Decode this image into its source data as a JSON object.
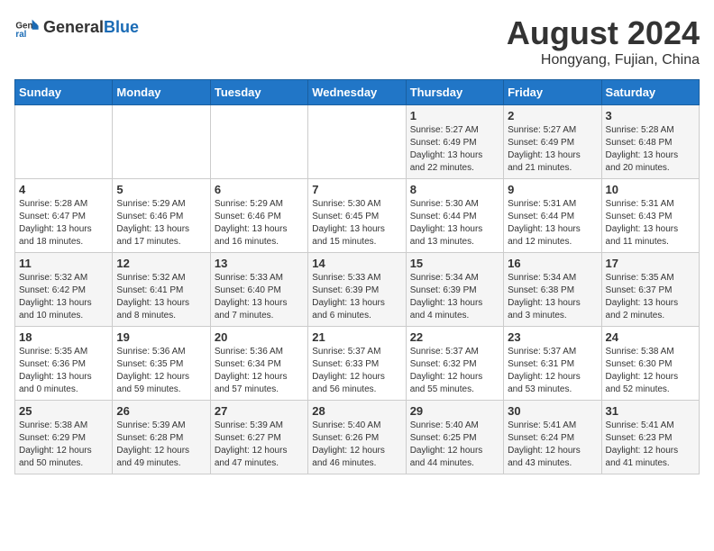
{
  "header": {
    "logo": {
      "general": "General",
      "blue": "Blue"
    },
    "title": "August 2024",
    "location": "Hongyang, Fujian, China"
  },
  "calendar": {
    "days_of_week": [
      "Sunday",
      "Monday",
      "Tuesday",
      "Wednesday",
      "Thursday",
      "Friday",
      "Saturday"
    ],
    "weeks": [
      [
        {
          "day": "",
          "info": ""
        },
        {
          "day": "",
          "info": ""
        },
        {
          "day": "",
          "info": ""
        },
        {
          "day": "",
          "info": ""
        },
        {
          "day": "1",
          "info": "Sunrise: 5:27 AM\nSunset: 6:49 PM\nDaylight: 13 hours and 22 minutes."
        },
        {
          "day": "2",
          "info": "Sunrise: 5:27 AM\nSunset: 6:49 PM\nDaylight: 13 hours and 21 minutes."
        },
        {
          "day": "3",
          "info": "Sunrise: 5:28 AM\nSunset: 6:48 PM\nDaylight: 13 hours and 20 minutes."
        }
      ],
      [
        {
          "day": "4",
          "info": "Sunrise: 5:28 AM\nSunset: 6:47 PM\nDaylight: 13 hours and 18 minutes."
        },
        {
          "day": "5",
          "info": "Sunrise: 5:29 AM\nSunset: 6:46 PM\nDaylight: 13 hours and 17 minutes."
        },
        {
          "day": "6",
          "info": "Sunrise: 5:29 AM\nSunset: 6:46 PM\nDaylight: 13 hours and 16 minutes."
        },
        {
          "day": "7",
          "info": "Sunrise: 5:30 AM\nSunset: 6:45 PM\nDaylight: 13 hours and 15 minutes."
        },
        {
          "day": "8",
          "info": "Sunrise: 5:30 AM\nSunset: 6:44 PM\nDaylight: 13 hours and 13 minutes."
        },
        {
          "day": "9",
          "info": "Sunrise: 5:31 AM\nSunset: 6:44 PM\nDaylight: 13 hours and 12 minutes."
        },
        {
          "day": "10",
          "info": "Sunrise: 5:31 AM\nSunset: 6:43 PM\nDaylight: 13 hours and 11 minutes."
        }
      ],
      [
        {
          "day": "11",
          "info": "Sunrise: 5:32 AM\nSunset: 6:42 PM\nDaylight: 13 hours and 10 minutes."
        },
        {
          "day": "12",
          "info": "Sunrise: 5:32 AM\nSunset: 6:41 PM\nDaylight: 13 hours and 8 minutes."
        },
        {
          "day": "13",
          "info": "Sunrise: 5:33 AM\nSunset: 6:40 PM\nDaylight: 13 hours and 7 minutes."
        },
        {
          "day": "14",
          "info": "Sunrise: 5:33 AM\nSunset: 6:39 PM\nDaylight: 13 hours and 6 minutes."
        },
        {
          "day": "15",
          "info": "Sunrise: 5:34 AM\nSunset: 6:39 PM\nDaylight: 13 hours and 4 minutes."
        },
        {
          "day": "16",
          "info": "Sunrise: 5:34 AM\nSunset: 6:38 PM\nDaylight: 13 hours and 3 minutes."
        },
        {
          "day": "17",
          "info": "Sunrise: 5:35 AM\nSunset: 6:37 PM\nDaylight: 13 hours and 2 minutes."
        }
      ],
      [
        {
          "day": "18",
          "info": "Sunrise: 5:35 AM\nSunset: 6:36 PM\nDaylight: 13 hours and 0 minutes."
        },
        {
          "day": "19",
          "info": "Sunrise: 5:36 AM\nSunset: 6:35 PM\nDaylight: 12 hours and 59 minutes."
        },
        {
          "day": "20",
          "info": "Sunrise: 5:36 AM\nSunset: 6:34 PM\nDaylight: 12 hours and 57 minutes."
        },
        {
          "day": "21",
          "info": "Sunrise: 5:37 AM\nSunset: 6:33 PM\nDaylight: 12 hours and 56 minutes."
        },
        {
          "day": "22",
          "info": "Sunrise: 5:37 AM\nSunset: 6:32 PM\nDaylight: 12 hours and 55 minutes."
        },
        {
          "day": "23",
          "info": "Sunrise: 5:37 AM\nSunset: 6:31 PM\nDaylight: 12 hours and 53 minutes."
        },
        {
          "day": "24",
          "info": "Sunrise: 5:38 AM\nSunset: 6:30 PM\nDaylight: 12 hours and 52 minutes."
        }
      ],
      [
        {
          "day": "25",
          "info": "Sunrise: 5:38 AM\nSunset: 6:29 PM\nDaylight: 12 hours and 50 minutes."
        },
        {
          "day": "26",
          "info": "Sunrise: 5:39 AM\nSunset: 6:28 PM\nDaylight: 12 hours and 49 minutes."
        },
        {
          "day": "27",
          "info": "Sunrise: 5:39 AM\nSunset: 6:27 PM\nDaylight: 12 hours and 47 minutes."
        },
        {
          "day": "28",
          "info": "Sunrise: 5:40 AM\nSunset: 6:26 PM\nDaylight: 12 hours and 46 minutes."
        },
        {
          "day": "29",
          "info": "Sunrise: 5:40 AM\nSunset: 6:25 PM\nDaylight: 12 hours and 44 minutes."
        },
        {
          "day": "30",
          "info": "Sunrise: 5:41 AM\nSunset: 6:24 PM\nDaylight: 12 hours and 43 minutes."
        },
        {
          "day": "31",
          "info": "Sunrise: 5:41 AM\nSunset: 6:23 PM\nDaylight: 12 hours and 41 minutes."
        }
      ]
    ]
  }
}
